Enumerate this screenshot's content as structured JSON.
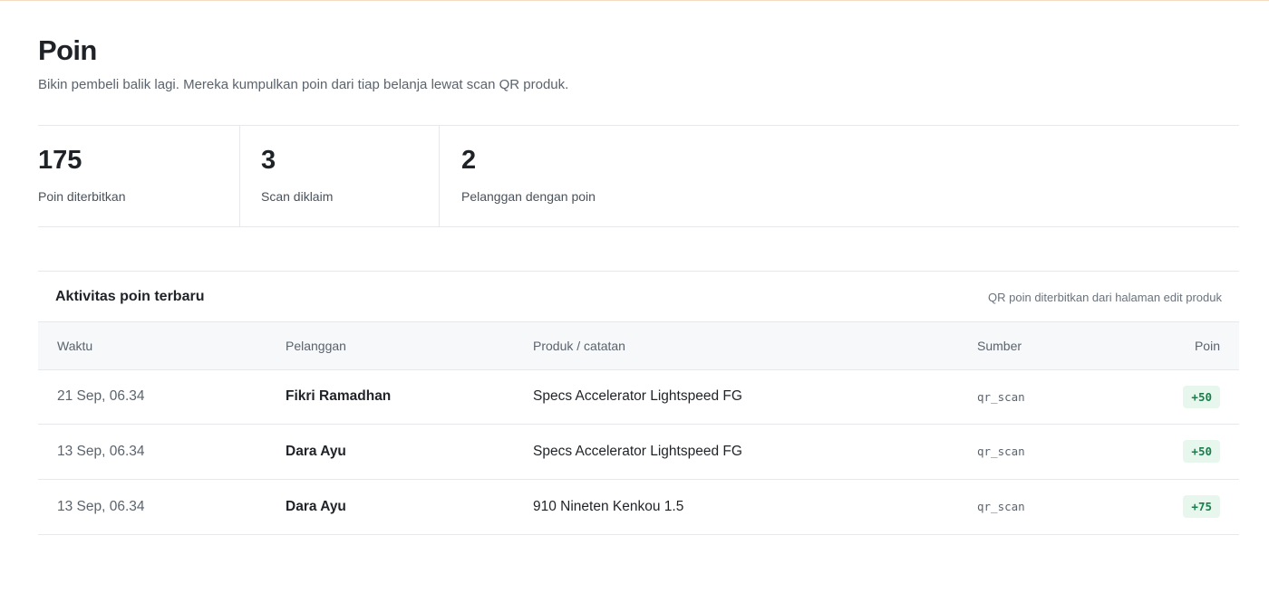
{
  "page": {
    "title": "Poin",
    "subtitle": "Bikin pembeli balik lagi. Mereka kumpulkan poin dari tiap belanja lewat scan QR produk."
  },
  "stats": [
    {
      "value": "175",
      "label": "Poin diterbitkan"
    },
    {
      "value": "3",
      "label": "Scan diklaim"
    },
    {
      "value": "2",
      "label": "Pelanggan dengan poin"
    }
  ],
  "activity": {
    "title": "Aktivitas poin terbaru",
    "note": "QR poin diterbitkan dari halaman edit produk",
    "columns": {
      "time": "Waktu",
      "customer": "Pelanggan",
      "product": "Produk / catatan",
      "source": "Sumber",
      "points": "Poin"
    },
    "rows": [
      {
        "time": "21 Sep, 06.34",
        "customer": "Fikri Ramadhan",
        "product": "Specs Accelerator Lightspeed FG",
        "source": "qr_scan",
        "points": "+50"
      },
      {
        "time": "13 Sep, 06.34",
        "customer": "Dara Ayu",
        "product": "Specs Accelerator Lightspeed FG",
        "source": "qr_scan",
        "points": "+50"
      },
      {
        "time": "13 Sep, 06.34",
        "customer": "Dara Ayu",
        "product": "910 Nineten Kenkou 1.5",
        "source": "qr_scan",
        "points": "+75"
      }
    ]
  },
  "colors": {
    "accent_line": "#f3dcc0",
    "badge_bg": "#e7f7ee",
    "badge_text": "#17804a"
  }
}
